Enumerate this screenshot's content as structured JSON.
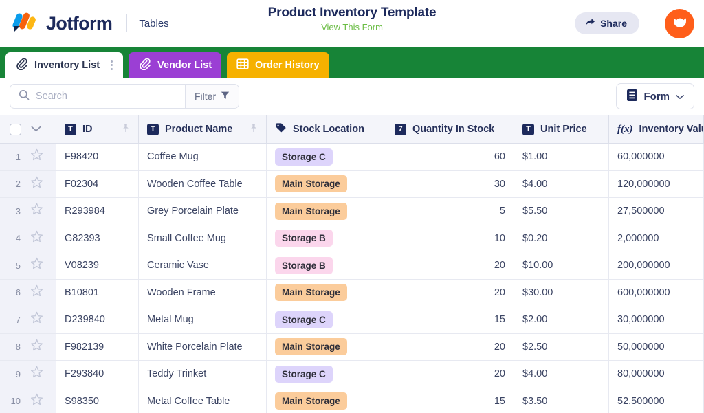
{
  "header": {
    "brand_name": "Jotform",
    "product_label": "Tables",
    "doc_title": "Product Inventory Template",
    "doc_subtitle": "View This Form",
    "share_label": "Share",
    "share_icon": "share-arrow-icon",
    "avatar_icon": "user-avatar-icon",
    "logo_icon": "jotform-logo-icon"
  },
  "tabs": [
    {
      "label": "Inventory List",
      "icon": "paperclip-icon",
      "state": "active",
      "color": "#ffffff"
    },
    {
      "label": "Vendor List",
      "icon": "paperclip-icon",
      "state": "inactive",
      "color": "#9b3fd4"
    },
    {
      "label": "Order History",
      "icon": "grid-table-icon",
      "state": "inactive",
      "color": "#f6b100"
    }
  ],
  "toolbar": {
    "search_placeholder": "Search",
    "search_value": "",
    "search_icon": "search-icon",
    "filter_label": "Filter",
    "filter_icon": "funnel-icon",
    "form_label": "Form",
    "form_icon": "form-document-icon",
    "form_chevron_icon": "chevron-down-icon"
  },
  "table": {
    "select_all_icon": "checkbox-icon",
    "expand_icon": "chevron-down-icon",
    "columns": [
      {
        "label": "ID",
        "type_icon": "text-field-icon",
        "glyph": "T",
        "pinned": true
      },
      {
        "label": "Product Name",
        "type_icon": "text-field-icon",
        "glyph": "T",
        "pinned": true
      },
      {
        "label": "Stock Location",
        "type_icon": "tag-icon",
        "glyph": "",
        "pinned": false
      },
      {
        "label": "Quantity In Stock",
        "type_icon": "number-field-icon",
        "glyph": "7",
        "pinned": false
      },
      {
        "label": "Unit Price",
        "type_icon": "text-field-icon",
        "glyph": "T",
        "pinned": false
      },
      {
        "label": "Inventory Value",
        "type_icon": "formula-icon",
        "glyph": "f(x)",
        "pinned": false
      }
    ],
    "rows": [
      {
        "num": "1",
        "id": "F98420",
        "name": "Coffee Mug",
        "location": "Storage C",
        "loc_color": "purple",
        "qty": "60",
        "price": "$1.00",
        "value": "60,000000"
      },
      {
        "num": "2",
        "id": "F02304",
        "name": "Wooden Coffee Table",
        "location": "Main Storage",
        "loc_color": "orange",
        "qty": "30",
        "price": "$4.00",
        "value": "120,000000"
      },
      {
        "num": "3",
        "id": "R293984",
        "name": "Grey Porcelain Plate",
        "location": "Main Storage",
        "loc_color": "orange",
        "qty": "5",
        "price": "$5.50",
        "value": "27,500000"
      },
      {
        "num": "4",
        "id": "G82393",
        "name": "Small Coffee Mug",
        "location": "Storage B",
        "loc_color": "pink",
        "qty": "10",
        "price": "$0.20",
        "value": "2,000000"
      },
      {
        "num": "5",
        "id": "V08239",
        "name": "Ceramic Vase",
        "location": "Storage B",
        "loc_color": "pink",
        "qty": "20",
        "price": "$10.00",
        "value": "200,000000"
      },
      {
        "num": "6",
        "id": "B10801",
        "name": "Wooden Frame",
        "location": "Main Storage",
        "loc_color": "orange",
        "qty": "20",
        "price": "$30.00",
        "value": "600,000000"
      },
      {
        "num": "7",
        "id": "D239840",
        "name": "Metal Mug",
        "location": "Storage C",
        "loc_color": "purple",
        "qty": "15",
        "price": "$2.00",
        "value": "30,000000"
      },
      {
        "num": "8",
        "id": "F982139",
        "name": "White Porcelain Plate",
        "location": "Main Storage",
        "loc_color": "orange",
        "qty": "20",
        "price": "$2.50",
        "value": "50,000000"
      },
      {
        "num": "9",
        "id": "F293840",
        "name": "Teddy Trinket",
        "location": "Storage C",
        "loc_color": "purple",
        "qty": "20",
        "price": "$4.00",
        "value": "80,000000"
      },
      {
        "num": "10",
        "id": "S98350",
        "name": "Metal Coffee Table",
        "location": "Main Storage",
        "loc_color": "orange",
        "qty": "15",
        "price": "$3.50",
        "value": "52,500000"
      }
    ],
    "row_star_icon": "star-icon",
    "pin_icon": "pin-icon"
  },
  "colors": {
    "brand_navy": "#1d2a5c",
    "green_band": "#178437",
    "link_green": "#6bbd45",
    "tab_purple": "#9b3fd4",
    "tab_amber": "#f6b100",
    "avatar_orange": "#ff5e1a"
  }
}
